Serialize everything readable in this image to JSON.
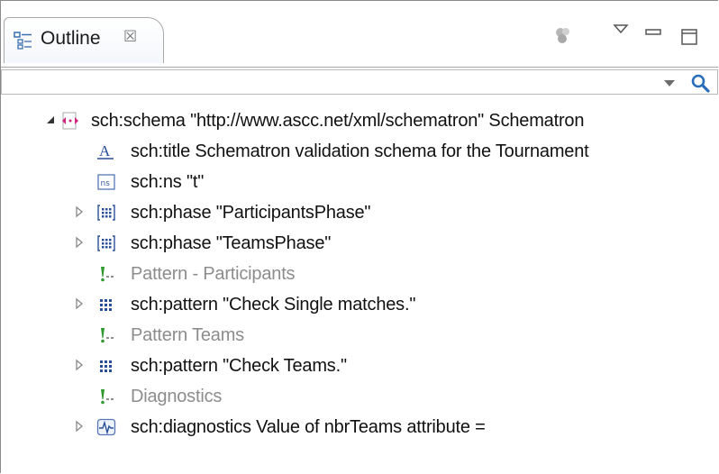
{
  "tab": {
    "label": "Outline",
    "close_glyph": "☒"
  },
  "filter": {
    "value": "",
    "placeholder": ""
  },
  "tree": [
    {
      "label": "sch:schema  \"http://www.ascc.net/xml/schematron\" Schematron",
      "icon": "schema-icon",
      "expanded": true,
      "comment": false
    },
    {
      "label": "sch:title  Schematron validation schema for the Tournament",
      "icon": "title-icon",
      "comment": false
    },
    {
      "label": "sch:ns  \"t\"",
      "icon": "namespace-icon",
      "comment": false
    },
    {
      "label": "sch:phase  \"ParticipantsPhase\"",
      "icon": "phase-icon",
      "expandable": true,
      "comment": false
    },
    {
      "label": "sch:phase  \"TeamsPhase\"",
      "icon": "phase-icon",
      "expandable": true,
      "comment": false
    },
    {
      "label": "Pattern - Participants",
      "icon": "comment-icon",
      "comment": true
    },
    {
      "label": "sch:pattern  \"Check Single matches.\"",
      "icon": "pattern-icon",
      "expandable": true,
      "comment": false
    },
    {
      "label": "Pattern Teams",
      "icon": "comment-icon",
      "comment": true
    },
    {
      "label": "sch:pattern  \"Check Teams.\"",
      "icon": "pattern-icon",
      "expandable": true,
      "comment": false
    },
    {
      "label": "Diagnostics",
      "icon": "comment-icon",
      "comment": true
    },
    {
      "label": "sch:diagnostics  Value of nbrTeams attribute =",
      "icon": "diagnostics-icon",
      "expandable": true,
      "comment": false
    }
  ],
  "colors": {
    "accent": "#2a6ebb",
    "comment_text": "#8c8c8c",
    "comment_icon": "#2e9a2e",
    "schema_icon": "#d2237f"
  }
}
